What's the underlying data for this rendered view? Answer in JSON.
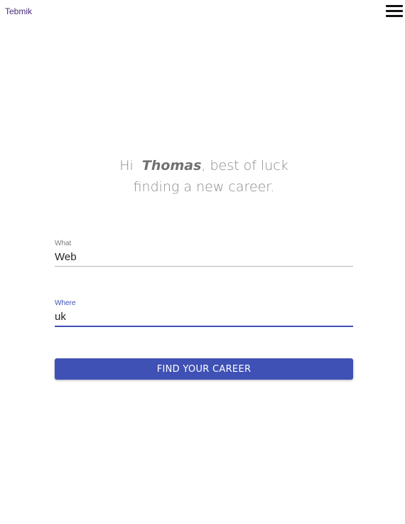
{
  "header": {
    "brand": "Tebmik",
    "menu_icon": "hamburger-menu-icon"
  },
  "greeting": {
    "hi": "Hi",
    "name": "Thomas",
    "rest_line1": ", best of luck",
    "line2": "finding a new career."
  },
  "form": {
    "what": {
      "label": "What",
      "value": "Web"
    },
    "where": {
      "label": "Where",
      "value": "uk"
    },
    "submit_label": "FIND YOUR CAREER"
  },
  "colors": {
    "accent": "#3f51b5",
    "brand_text": "#4a2a7a",
    "greeting_text": "#8a8a8a"
  }
}
